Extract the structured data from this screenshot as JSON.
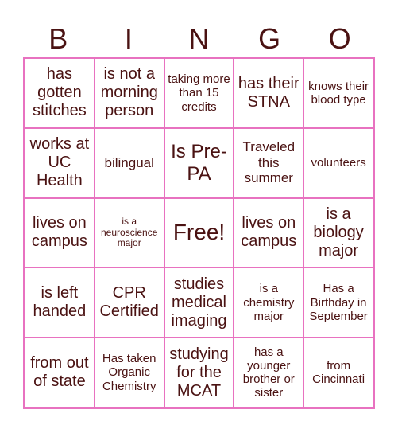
{
  "header": [
    "B",
    "I",
    "N",
    "G",
    "O"
  ],
  "colors": {
    "border": "#e872c0",
    "text": "#4a1212"
  },
  "cells": [
    {
      "text": "has gotten stitches",
      "size": "l"
    },
    {
      "text": "is not a morning person",
      "size": "l"
    },
    {
      "text": "taking more than 15 credits",
      "size": "s"
    },
    {
      "text": "has their STNA",
      "size": "l"
    },
    {
      "text": "knows their blood type",
      "size": "s"
    },
    {
      "text": "works at UC Health",
      "size": "l"
    },
    {
      "text": "bilingual",
      "size": "m"
    },
    {
      "text": "Is Pre-PA",
      "size": "xl-pre"
    },
    {
      "text": "Traveled this summer",
      "size": "m"
    },
    {
      "text": "volunteers",
      "size": "s"
    },
    {
      "text": "lives on campus",
      "size": "l"
    },
    {
      "text": "is a neuroscience major",
      "size": "xs"
    },
    {
      "text": "Free!",
      "size": "xl"
    },
    {
      "text": "lives on campus",
      "size": "l"
    },
    {
      "text": "is a biology major",
      "size": "l"
    },
    {
      "text": "is left handed",
      "size": "l"
    },
    {
      "text": "CPR Certified",
      "size": "l"
    },
    {
      "text": "studies medical imaging",
      "size": "l"
    },
    {
      "text": "is a chemistry major",
      "size": "s"
    },
    {
      "text": "Has a Birthday in September",
      "size": "s"
    },
    {
      "text": "from out of state",
      "size": "l"
    },
    {
      "text": "Has taken Organic Chemistry",
      "size": "s"
    },
    {
      "text": "studying for the MCAT",
      "size": "l"
    },
    {
      "text": "has a younger brother or sister",
      "size": "s"
    },
    {
      "text": "from Cincinnati",
      "size": "s"
    }
  ]
}
